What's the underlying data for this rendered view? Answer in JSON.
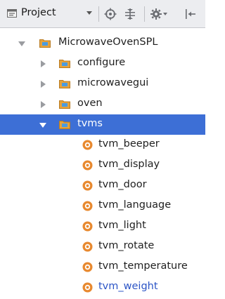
{
  "toolbar": {
    "view_label": "Project",
    "icons": [
      "project-view-icon",
      "dropdown-arrow-icon",
      "scroll-from-source-icon",
      "collapse-all-icon",
      "settings-gear-icon",
      "hide-panel-icon"
    ]
  },
  "tree": {
    "root": {
      "label": "MicrowaveOvenSPL",
      "expanded": true
    },
    "folders": [
      {
        "label": "configure",
        "expanded": false
      },
      {
        "label": "microwavegui",
        "expanded": false
      },
      {
        "label": "oven",
        "expanded": false
      },
      {
        "label": "tvms",
        "expanded": true,
        "selected": true
      }
    ],
    "files": [
      {
        "label": "tvm_beeper"
      },
      {
        "label": "tvm_display"
      },
      {
        "label": "tvm_door"
      },
      {
        "label": "tvm_language"
      },
      {
        "label": "tvm_light"
      },
      {
        "label": "tvm_rotate"
      },
      {
        "label": "tvm_temperature"
      },
      {
        "label": "tvm_weight"
      }
    ]
  },
  "colors": {
    "selection": "#3d6fd6",
    "folder_fill": "#e8a33a",
    "folder_badge": "#4a9be0",
    "class_icon": "#e8892f",
    "highlight_text": "#2c55c6",
    "toolbar_bg": "#ecedf0"
  }
}
